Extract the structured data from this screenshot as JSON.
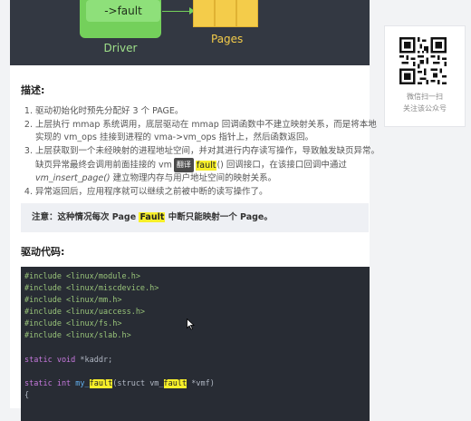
{
  "diagram": {
    "fault_label": "->fault",
    "driver_label": "Driver",
    "pages_label": "Pages"
  },
  "description": {
    "heading": "描述:",
    "steps": [
      {
        "text": "驱动初始化时预先分配好 3 个 PAGE。"
      },
      {
        "text": "上层执行 mmap 系统调用，底层驱动在 mmap 回调函数中不建立映射关系，而是将本地实现的 vm_ops 挂接到进程的 vma->vm_ops 指针上，然后函数返回。"
      },
      {
        "part1": "上层获取到一个未经映射的进程地址空间，并对其进行内存读写操作，导致触发缺页异常。缺页异常最终会调用前面挂接的 vm",
        "tooltip": "翻译",
        "highlight": "fault",
        "part2": "() 回调接口，在该接口回调中通过 ",
        "italic": "vm_insert_page()",
        "part3": " 建立物理内存与用户地址空间的映射关系。"
      },
      {
        "text": "异常返回后，应用程序就可以继续之前被中断的读写操作了。"
      }
    ]
  },
  "note": {
    "prefix": "注意：这种情况每次 Page ",
    "highlight": "Fault",
    "suffix": " 中断只能映射一个 Page。"
  },
  "code_section": {
    "heading": "驱动代码:",
    "includes": [
      "#include <linux/module.h>",
      "#include <linux/miscdevice.h>",
      "#include <linux/mm.h>",
      "#include <linux/uaccess.h>",
      "#include <linux/fs.h>",
      "#include <linux/slab.h>"
    ],
    "line_kaddr": {
      "kw": "static void ",
      "rest": "*kaddr;"
    },
    "line_fn": {
      "kw": "static int ",
      "name_a": "my_",
      "name_hl": "fault",
      "mid": "(struct vm_",
      "mid_hl": "fault",
      "end": " *vmf)"
    },
    "brace": "{"
  },
  "sidebar": {
    "line1": "微信扫一扫",
    "line2": "关注该公众号"
  },
  "colors": {
    "highlight": "#f7ef2a",
    "code_bg": "#282c34",
    "driver_green": "#74d05b",
    "page_yellow": "#f4cc4a"
  }
}
